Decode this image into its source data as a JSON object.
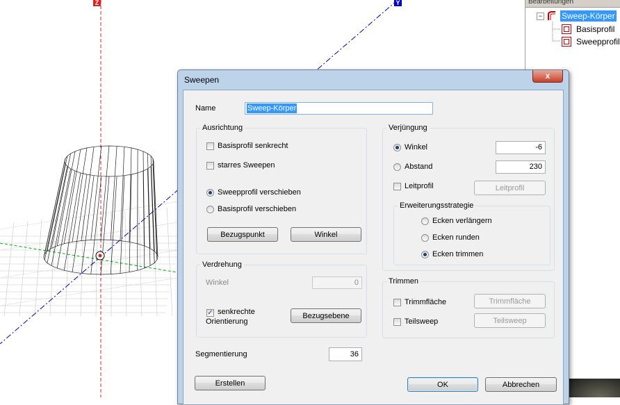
{
  "viewport": {
    "axis_z_label": "Z",
    "axis_y_label": "Y",
    "colors": {
      "z_axis": "#e02020",
      "y_axis": "#0000cc",
      "x_axis": "#00b000",
      "grid": "#c8c8c8",
      "wire": "#222222"
    }
  },
  "tree": {
    "header": "Bearbeitungen",
    "root_label": "Sweep-Körper",
    "children": [
      "Basisprofil",
      "Sweepprofil"
    ]
  },
  "dialog": {
    "title": "Sweepen",
    "close_glyph": "x",
    "name_label": "Name",
    "name_value": "Sweep-Körper",
    "ausrichtung": {
      "title": "Ausrichtung",
      "cb_basisprofil_senkrecht": "Basisprofil senkrecht",
      "cb_basisprofil_senkrecht_checked": false,
      "cb_starres_sweepen": "starres Sweepen",
      "cb_starres_sweepen_checked": false,
      "rb_sweepprofil_verschieben": "Sweepprofil verschieben",
      "rb_basisprofil_verschieben": "Basisprofil verschieben",
      "selected": "Sweepprofil verschieben",
      "btn_bezugspunkt": "Bezugspunkt",
      "btn_winkel": "Winkel"
    },
    "verdrehung": {
      "title": "Verdrehung",
      "winkel_label": "Winkel",
      "winkel_value": "0",
      "cb_senkrechte_line1": "senkrechte",
      "cb_senkrechte_line2": "Orientierung",
      "cb_senkrechte_checked": true,
      "btn_bezugsebene": "Bezugsebene"
    },
    "segmentierung_label": "Segmentierung",
    "segmentierung_value": "36",
    "verjuengung": {
      "title": "Verjüngung",
      "rb_winkel": "Winkel",
      "winkel_value": "-6",
      "rb_abstand": "Abstand",
      "abstand_value": "230",
      "selected": "Winkel",
      "cb_leitprofil": "Leitprofil",
      "cb_leitprofil_checked": false,
      "btn_leitprofil": "Leitprofil",
      "erweiterung": {
        "title": "Erweiterungsstrategie",
        "options": [
          "Ecken verlängern",
          "Ecken runden",
          "Ecken trimmen"
        ],
        "selected": "Ecken trimmen"
      }
    },
    "trimmen": {
      "title": "Trimmen",
      "cb_trimmflaeche": "Trimmfläche",
      "cb_trimmflaeche_checked": false,
      "btn_trimmflaeche": "Trimmfläche",
      "cb_teilsweep": "Teilsweep",
      "cb_teilsweep_checked": false,
      "btn_teilsweep": "Teilsweep"
    },
    "btn_erstellen": "Erstellen",
    "btn_ok": "OK",
    "btn_abbrechen": "Abbrechen"
  }
}
